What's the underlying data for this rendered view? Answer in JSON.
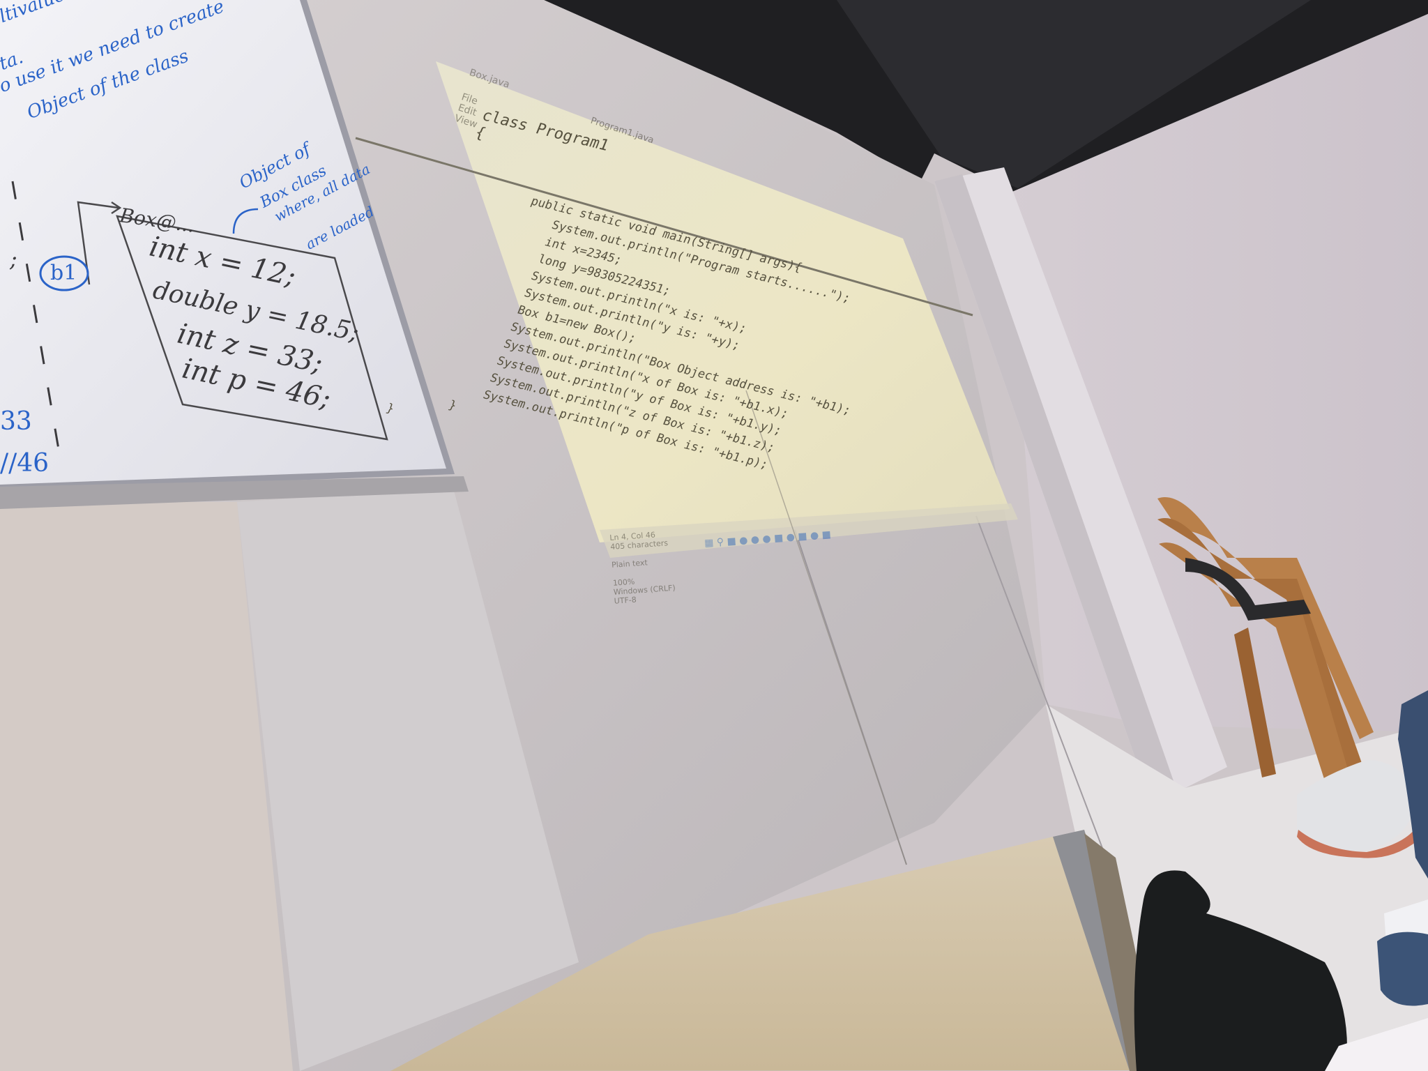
{
  "whiteboard": {
    "blue_notes": [
      "ltivalued/ User D",
      "ta.",
      "o use it we need to create",
      "Object of the class"
    ],
    "annotation": [
      "Object of",
      "Box class",
      "where, all data",
      "are loaded"
    ],
    "heading": "Box@...",
    "reference": "b1",
    "members": [
      "int x = 12;",
      "double y = 18.5;",
      "int z = 33;",
      "int p = 46;"
    ],
    "left_values": [
      ";",
      "33",
      "//46"
    ]
  },
  "projection": {
    "window_title": "Box.java",
    "menu": [
      "File",
      "Edit",
      "View"
    ],
    "tab_label": "Program1.java",
    "code_lines": [
      "class Program1",
      "{",
      "        public static void main(String[] args){",
      "            System.out.println(\"Program starts......\");",
      "            int x=2345;",
      "            long y=98305224351;",
      "            System.out.println(\"x is: \"+x);",
      "            System.out.println(\"y is: \"+y);",
      "            Box b1=new Box();",
      "            System.out.println(\"Box Object address is: \"+b1);",
      "            System.out.println(\"x of Box is: \"+b1.x);",
      "            System.out.println(\"y of Box is: \"+b1.y);",
      "            System.out.println(\"z of Box is: \"+b1.z);",
      "            System.out.println(\"p of Box is: \"+b1.p);",
      "        }",
      "}"
    ],
    "status_position": "Ln 4, Col 46",
    "status_chars": "405 characters",
    "status_format": "Plain text",
    "status_zoom": "100%",
    "status_eol": "Windows (CRLF)",
    "status_encoding": "UTF-8"
  }
}
